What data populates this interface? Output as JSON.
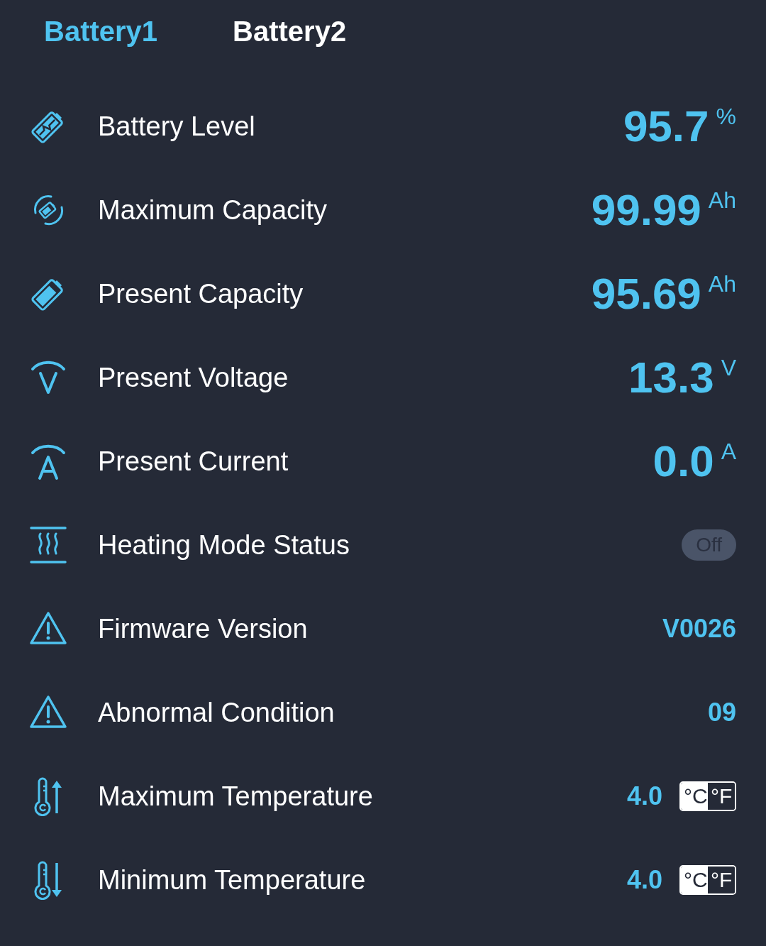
{
  "tabs": [
    {
      "label": "Battery1",
      "selected": true
    },
    {
      "label": "Battery2",
      "selected": false
    }
  ],
  "rows": [
    {
      "kind": "big",
      "label": "Battery Level",
      "value": "95.7",
      "unit": "%"
    },
    {
      "kind": "big",
      "label": "Maximum Capacity",
      "value": "99.99",
      "unit": "Ah"
    },
    {
      "kind": "big",
      "label": "Present Capacity",
      "value": "95.69",
      "unit": "Ah"
    },
    {
      "kind": "big",
      "label": "Present Voltage",
      "value": "13.3",
      "unit": "V"
    },
    {
      "kind": "big",
      "label": "Present Current",
      "value": "0.0",
      "unit": "A"
    },
    {
      "kind": "switch",
      "label": "Heating Mode Status",
      "on": false,
      "value": "Off"
    },
    {
      "kind": "text",
      "label": "Firmware Version",
      "value": "V0026"
    },
    {
      "kind": "text",
      "label": "Abnormal Condition",
      "value": "09"
    },
    {
      "kind": "temp",
      "label": "Maximum Temperature",
      "value": "4.0",
      "units": [
        {
          "label": "°C",
          "selected": true
        },
        {
          "label": "°F",
          "selected": false
        }
      ]
    },
    {
      "kind": "temp",
      "label": "Minimum Temperature",
      "value": "4.0",
      "units": [
        {
          "label": "°C",
          "selected": true
        },
        {
          "label": "°F",
          "selected": false
        }
      ]
    }
  ]
}
